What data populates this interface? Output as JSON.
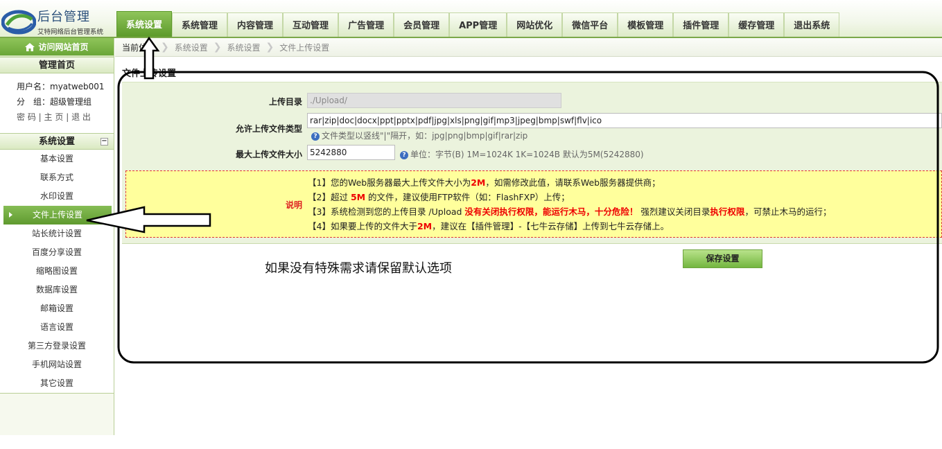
{
  "app": {
    "logo_title": "后台管理",
    "logo_subtitle": "艾特网络后台管理系统"
  },
  "nav": {
    "tabs": [
      {
        "label": "系统设置",
        "active": true
      },
      {
        "label": "系统管理"
      },
      {
        "label": "内容管理"
      },
      {
        "label": "互动管理"
      },
      {
        "label": "广告管理"
      },
      {
        "label": "会员管理"
      },
      {
        "label": "APP管理"
      },
      {
        "label": "网站优化"
      },
      {
        "label": "微信平台"
      },
      {
        "label": "模板管理"
      },
      {
        "label": "插件管理"
      },
      {
        "label": "缓存管理"
      },
      {
        "label": "退出系统"
      }
    ]
  },
  "sidebar": {
    "visit_label": "访问网站首页",
    "home_heading": "管理首页",
    "user_line": "用户名：myatweb001",
    "group_line": "分　组：超级管理组",
    "links": {
      "password": "密 码",
      "home": "主 页",
      "logout": "退 出",
      "sep": "|"
    },
    "section_heading": "系统设置",
    "collapse_symbol": "−",
    "items": [
      {
        "label": "基本设置"
      },
      {
        "label": "联系方式"
      },
      {
        "label": "水印设置"
      },
      {
        "label": "文件上传设置",
        "active": true
      },
      {
        "label": "站长统计设置"
      },
      {
        "label": "百度分享设置"
      },
      {
        "label": "缩略图设置"
      },
      {
        "label": "数据库设置"
      },
      {
        "label": "邮箱设置"
      },
      {
        "label": "语言设置"
      },
      {
        "label": "第三方登录设置"
      },
      {
        "label": "手机网站设置"
      },
      {
        "label": "其它设置"
      }
    ]
  },
  "breadcrumb": [
    "当前位置",
    "系统设置",
    "系统设置",
    "文件上传设置"
  ],
  "page": {
    "section_title": "文件上传设置",
    "upload_dir_label": "上传目录",
    "upload_dir_value": "./Upload/",
    "allowed_types_label": "允许上传文件类型",
    "allowed_types_value": "rar|zip|doc|docx|ppt|pptx|pdf|jpg|xls|png|gif|mp3|jpeg|bmp|swf|flv|ico",
    "allowed_types_hint": "文件类型以竖线\"|\"隔开，如：jpg|png|bmp|gif|rar|zip",
    "max_size_label": "最大上传文件大小",
    "max_size_value": "5242880",
    "max_size_hint": "单位：字节(B)  1M=1024K  1K=1024B  默认为5M(5242880)",
    "help_icon": "?",
    "notice_label": "说明",
    "notice": {
      "l1a": "【1】您的Web服务器最大上传文件大小为",
      "l1b": "2M",
      "l1c": "，如需修改此值，请联系Web服务器提供商；",
      "l2a": "【2】超过 ",
      "l2b": "5M",
      "l2c": " 的文件，建议使用FTP软件（如：FlashFXP）上传；",
      "l3a": "【3】系统检测到您的上传目录 /Upload ",
      "l3b": "没有关闭执行权限，能运行木马，十分危险！",
      "l3c": " 强烈建议关闭目录",
      "l3d": "执行权限",
      "l3e": "，可禁止木马的运行；",
      "l4a": "【4】如果要上传的文件大于",
      "l4b": "2M",
      "l4c": "，建议在【插件管理】-【七牛云存储】上传到七牛云存储上。"
    },
    "tip": "如果没有特殊需求请保留默认选项",
    "save_label": "保存设置"
  },
  "colors": {
    "accent_green": "#6aa637",
    "notice_bg": "#ffff9c",
    "warning_red": "#e00000"
  },
  "icons": {
    "home": "home-icon",
    "help": "question-icon",
    "arrow": "arrow-annotation"
  }
}
